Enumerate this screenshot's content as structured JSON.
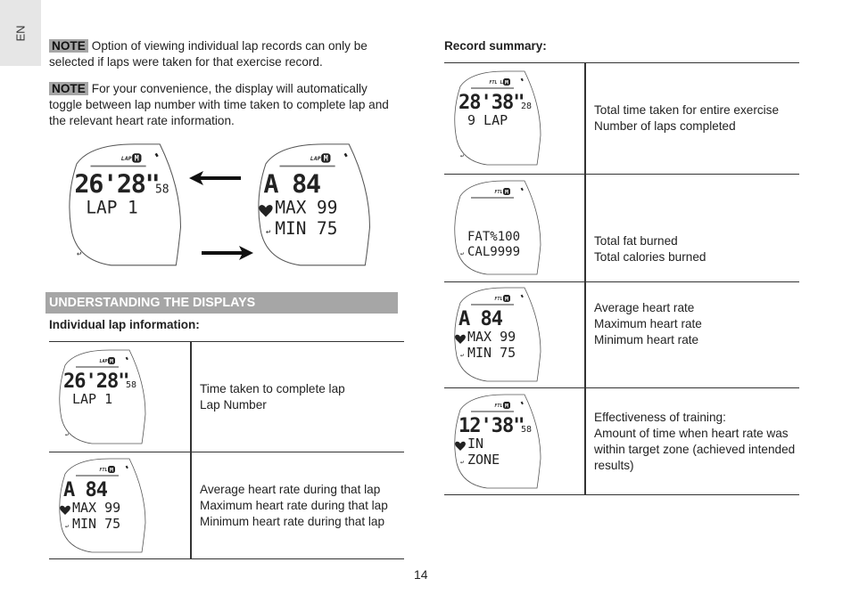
{
  "language_tab": "EN",
  "notes": [
    {
      "tag": "NOTE",
      "text": "Option of viewing individual lap records can only be selected if laps were taken for that exercise record."
    },
    {
      "tag": "NOTE",
      "text": "For your convenience, the display will automatically toggle between lap number with time taken to complete lap and the relevant heart rate information."
    }
  ],
  "toggle_illustration": {
    "display_a": {
      "icons": [
        "LAP",
        "M"
      ],
      "main": "26'28\"",
      "sub_seconds": "58",
      "line2": "LAP   1",
      "line3": ""
    },
    "display_b": {
      "icons": [
        "LAP",
        "M"
      ],
      "main": "A 84",
      "line2": "MAX  99",
      "line3": "MIN  75"
    }
  },
  "section_title": "UNDERSTANDING THE DISPLAYS",
  "individual_lap": {
    "heading": "Individual lap information:",
    "rows": [
      {
        "display": {
          "icons": [
            "LAP",
            "M"
          ],
          "main": "26'28\"",
          "sub_seconds": "58",
          "line2": "LAP   1",
          "line3": ""
        },
        "description": [
          "Time taken to complete lap",
          "Lap Number"
        ]
      },
      {
        "display": {
          "icons": [
            "FTL",
            "M"
          ],
          "main": "A 84",
          "line2": "MAX  99",
          "line3": "MIN  75"
        },
        "description": [
          "Average heart rate during that lap",
          "Maximum heart rate during that lap",
          "Minimum heart rate during that lap"
        ]
      }
    ]
  },
  "record_summary": {
    "heading": "Record summary:",
    "rows": [
      {
        "display": {
          "icons": [
            "FTL LAP",
            "M"
          ],
          "main": "28'38\"",
          "sub_seconds": "28",
          "line2": "9 LAP",
          "line3": ""
        },
        "description": [
          "Total time taken for entire exercise",
          "Number of laps completed"
        ]
      },
      {
        "display": {
          "icons": [
            "FTL",
            "M"
          ],
          "main": "",
          "line2": "FAT%100",
          "line3": "CAL9999"
        },
        "description": [
          "Total fat burned",
          "Total calories burned"
        ]
      },
      {
        "display": {
          "icons": [
            "FTL",
            "M"
          ],
          "main": "A 84",
          "line2": "MAX  99",
          "line3": "MIN  75"
        },
        "description": [
          "Average heart rate",
          "Maximum heart rate",
          "Minimum heart rate"
        ]
      },
      {
        "display": {
          "icons": [
            "FTL",
            "M"
          ],
          "main": "12'38\"",
          "sub_seconds": "58",
          "line2": "IN",
          "line3": "ZONE"
        },
        "description": [
          "Effectiveness of training:",
          "Amount of time when heart rate was within target zone (achieved intended results)"
        ]
      }
    ]
  },
  "page_number": "14"
}
